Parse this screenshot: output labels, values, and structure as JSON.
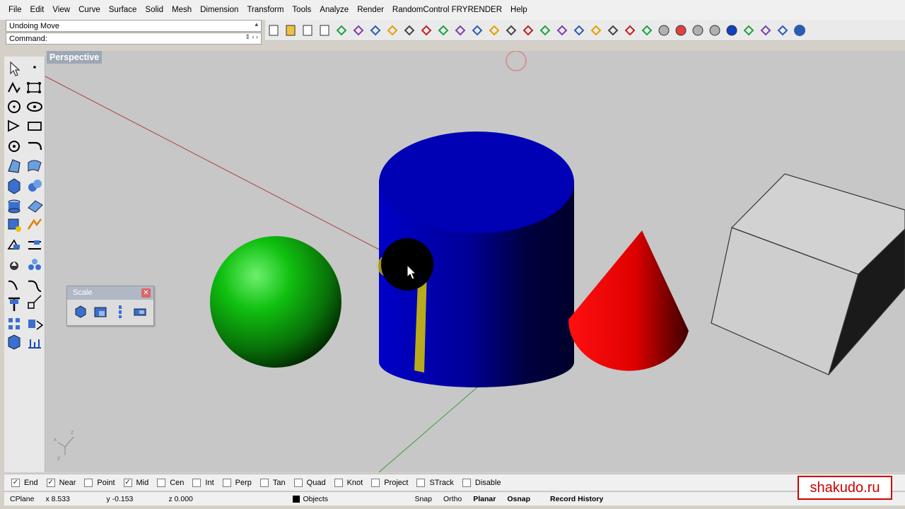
{
  "menu": [
    "File",
    "Edit",
    "View",
    "Curve",
    "Surface",
    "Solid",
    "Mesh",
    "Dimension",
    "Transform",
    "Tools",
    "Analyze",
    "Render",
    "RandomControl FRYRENDER",
    "Help"
  ],
  "command_history": "Undoing Move",
  "command_prompt": "Command:",
  "viewport": {
    "title": "Perspective"
  },
  "scale_panel": {
    "title": "Scale",
    "close_symbol": "✕"
  },
  "osnaps": [
    {
      "label": "End",
      "checked": true,
      "mark": "✓"
    },
    {
      "label": "Near",
      "checked": true,
      "mark": "✓"
    },
    {
      "label": "Point",
      "checked": false,
      "mark": ""
    },
    {
      "label": "Mid",
      "checked": true,
      "mark": "✓"
    },
    {
      "label": "Cen",
      "checked": false,
      "mark": ""
    },
    {
      "label": "Int",
      "checked": false,
      "mark": ""
    },
    {
      "label": "Perp",
      "checked": false,
      "mark": ""
    },
    {
      "label": "Tan",
      "checked": false,
      "mark": ""
    },
    {
      "label": "Quad",
      "checked": false,
      "mark": ""
    },
    {
      "label": "Knot",
      "checked": false,
      "mark": ""
    },
    {
      "label": "Project",
      "checked": false,
      "mark": ""
    },
    {
      "label": "STrack",
      "checked": false,
      "mark": ""
    },
    {
      "label": "Disable",
      "checked": false,
      "mark": ""
    }
  ],
  "status": {
    "cplane": "CPlane",
    "x": "x 8.533",
    "y": "y -0.153",
    "z": "z 0.000",
    "layer": "Objects",
    "snap": "Snap",
    "ortho": "Ortho",
    "planar": "Planar",
    "osnap": "Osnap",
    "record_history": "Record History"
  },
  "watermark": "shakudo.ru",
  "toolbar_icons": [
    "new-icon",
    "open-icon",
    "save-icon",
    "print-icon",
    "import-icon",
    "cut-icon",
    "copy-icon",
    "paste-icon",
    "undo-icon",
    "pan-icon",
    "move-icon",
    "zoom-icon",
    "zoom-window-icon",
    "zoom-extents-icon",
    "zoom-selected-icon",
    "rotate-view-icon",
    "grid-icon",
    "car-icon",
    "eye-icon",
    "target-icon",
    "paint-icon",
    "lightbulb-icon",
    "lock-icon",
    "layer-icon",
    "color-wheel-icon",
    "sphere-wire-icon",
    "sphere-shade-icon",
    "sphere-render-icon",
    "cursor-tool-icon",
    "gear-icon",
    "options-icon",
    "help-icon"
  ],
  "colors": {
    "cylinder": "#0000b8",
    "sphere": "#10b010",
    "cone": "#e00000",
    "box": "#c8c8c8",
    "viewport_bg": "#c7c7c7",
    "watermark": "#cc0000"
  }
}
